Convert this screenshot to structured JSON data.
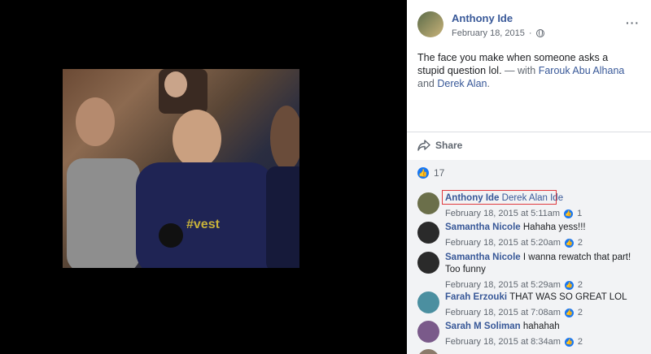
{
  "post": {
    "author": "Anthony Ide",
    "date": "February 18, 2015",
    "more_icon": "ellipsis-icon",
    "caption": {
      "text": "The face you make when someone asks a stupid question lol.",
      "separator": "— with",
      "tag1": "Farouk Abu Alhana",
      "and": "and",
      "tag2": "Derek Alan",
      "end": "."
    },
    "share_label": "Share",
    "like_count": "17"
  },
  "photo_overlay_text": "#vest",
  "comments": [
    {
      "name": "Anthony Ide",
      "text": "",
      "tag": "Derek Alan Ide",
      "time": "February 18, 2015 at 5:11am",
      "likes": "1",
      "avatar_color": "#6b6f4a"
    },
    {
      "name": "Samantha Nicole",
      "text": "Hahaha yess!!!",
      "tag": "",
      "time": "February 18, 2015 at 5:20am",
      "likes": "2",
      "avatar_color": "#2a2a2a"
    },
    {
      "name": "Samantha Nicole",
      "text": "I wanna rewatch that part! Too funny",
      "tag": "",
      "time": "February 18, 2015 at 5:29am",
      "likes": "2",
      "avatar_color": "#2a2a2a"
    },
    {
      "name": "Farah Erzouki",
      "text": "THAT WAS SO GREAT LOL",
      "tag": "",
      "time": "February 18, 2015 at 7:08am",
      "likes": "2",
      "avatar_color": "#4b8fa0"
    },
    {
      "name": "Sarah M Soliman",
      "text": "hahahah",
      "tag": "",
      "time": "February 18, 2015 at 8:34am",
      "likes": "2",
      "avatar_color": "#7a5a8a"
    }
  ],
  "colors": {
    "link": "#385898",
    "like": "#1877f2",
    "highlight": "#e0393e"
  }
}
